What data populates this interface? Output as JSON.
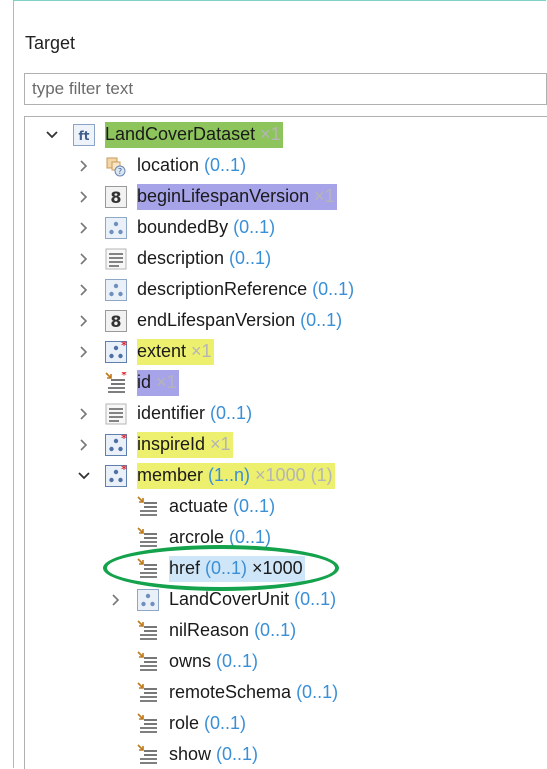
{
  "panel": {
    "title": "Target",
    "filter_placeholder": "type filter text"
  },
  "colors": {
    "highlight_green": "#8dc45c",
    "highlight_yellow": "#edf06e",
    "highlight_purple": "#a7a3e8",
    "cardinality_blue": "#3a8fd6",
    "multiplicity_gray": "#b5b5b5",
    "annotation_ellipse": "#14a24c"
  },
  "tree": [
    {
      "name": "LandCoverDataset",
      "card": "",
      "mult": "×1",
      "level": 0,
      "toggle": "expanded",
      "icon": "feature-type-icon",
      "hl": "green"
    },
    {
      "name": "location",
      "card": "(0..1)",
      "mult": "",
      "level": 1,
      "toggle": "collapsed",
      "icon": "geometry-icon",
      "hl": ""
    },
    {
      "name": "beginLifespanVersion",
      "card": "",
      "mult": "×1",
      "level": 1,
      "toggle": "collapsed",
      "icon": "number-type-icon",
      "hl": "purple"
    },
    {
      "name": "boundedBy",
      "card": "(0..1)",
      "mult": "",
      "level": 1,
      "toggle": "collapsed",
      "icon": "complex-type-icon",
      "hl": ""
    },
    {
      "name": "description",
      "card": "(0..1)",
      "mult": "",
      "level": 1,
      "toggle": "collapsed",
      "icon": "text-type-icon",
      "hl": ""
    },
    {
      "name": "descriptionReference",
      "card": "(0..1)",
      "mult": "",
      "level": 1,
      "toggle": "collapsed",
      "icon": "complex-type-icon",
      "hl": ""
    },
    {
      "name": "endLifespanVersion",
      "card": "(0..1)",
      "mult": "",
      "level": 1,
      "toggle": "collapsed",
      "icon": "number-type-icon",
      "hl": ""
    },
    {
      "name": "extent",
      "card": "",
      "mult": "×1",
      "level": 1,
      "toggle": "collapsed",
      "icon": "complex-type-required-icon",
      "hl": "yellow"
    },
    {
      "name": "id",
      "card": "",
      "mult": "×1",
      "level": 1,
      "toggle": "none",
      "icon": "attribute-required-icon",
      "hl": "purple"
    },
    {
      "name": "identifier",
      "card": "(0..1)",
      "mult": "",
      "level": 1,
      "toggle": "collapsed",
      "icon": "text-type-icon",
      "hl": ""
    },
    {
      "name": "inspireId",
      "card": "",
      "mult": "×1",
      "level": 1,
      "toggle": "collapsed",
      "icon": "complex-type-required-icon",
      "hl": "yellow"
    },
    {
      "name": "member",
      "card": "(1..n)",
      "mult": "×1000 (1)",
      "level": 1,
      "toggle": "expanded",
      "icon": "complex-type-required-icon",
      "hl": "yellow"
    },
    {
      "name": "actuate",
      "card": "(0..1)",
      "mult": "",
      "level": 2,
      "toggle": "none",
      "icon": "attribute-icon",
      "hl": ""
    },
    {
      "name": "arcrole",
      "card": "(0..1)",
      "mult": "",
      "level": 2,
      "toggle": "none",
      "icon": "attribute-icon",
      "hl": ""
    },
    {
      "name": "href",
      "card": "(0..1)",
      "mult": "×1000",
      "level": 2,
      "toggle": "none",
      "icon": "attribute-icon",
      "hl": "sel"
    },
    {
      "name": "LandCoverUnit",
      "card": "(0..1)",
      "mult": "",
      "level": 2,
      "toggle": "collapsed",
      "icon": "complex-type-icon",
      "hl": ""
    },
    {
      "name": "nilReason",
      "card": "(0..1)",
      "mult": "",
      "level": 2,
      "toggle": "none",
      "icon": "attribute-icon",
      "hl": ""
    },
    {
      "name": "owns",
      "card": "(0..1)",
      "mult": "",
      "level": 2,
      "toggle": "none",
      "icon": "attribute-icon",
      "hl": ""
    },
    {
      "name": "remoteSchema",
      "card": "(0..1)",
      "mult": "",
      "level": 2,
      "toggle": "none",
      "icon": "attribute-icon",
      "hl": ""
    },
    {
      "name": "role",
      "card": "(0..1)",
      "mult": "",
      "level": 2,
      "toggle": "none",
      "icon": "attribute-icon",
      "hl": ""
    },
    {
      "name": "show",
      "card": "(0..1)",
      "mult": "",
      "level": 2,
      "toggle": "none",
      "icon": "attribute-icon",
      "hl": ""
    }
  ]
}
